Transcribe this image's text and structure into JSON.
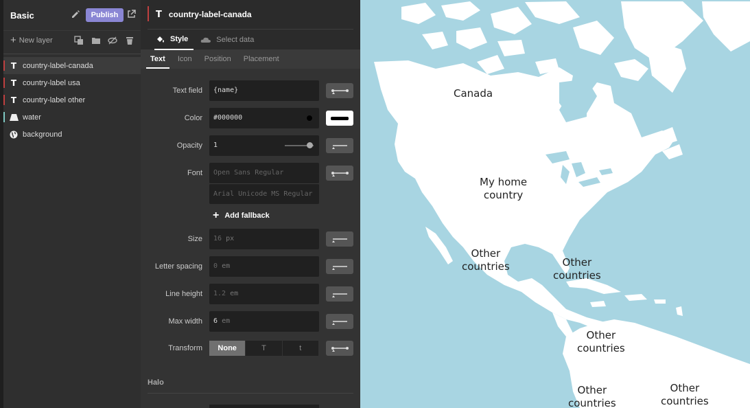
{
  "app": {
    "title": "Basic",
    "publish_label": "Publish",
    "new_layer_label": "New layer"
  },
  "layers": [
    {
      "name": "country-label-canada",
      "type": "symbol",
      "bar_color": "#c04040",
      "active": true
    },
    {
      "name": "country-label usa",
      "type": "symbol",
      "bar_color": "#c04040",
      "active": false
    },
    {
      "name": "country-label other",
      "type": "symbol",
      "bar_color": "#c04040",
      "active": false
    },
    {
      "name": "water",
      "type": "fill",
      "bar_color": "#7fc9c3",
      "active": false
    },
    {
      "name": "background",
      "type": "background",
      "bar_color": "",
      "active": false
    }
  ],
  "editor": {
    "layer_icon": "T",
    "layer_name": "country-label-canada",
    "tabs": {
      "style": "Style",
      "select_data": "Select data"
    },
    "sub_tabs": [
      "Text",
      "Icon",
      "Position",
      "Placement"
    ],
    "active_sub_tab": "Text",
    "properties": {
      "text_field": {
        "label": "Text field",
        "value": "{name}"
      },
      "color": {
        "label": "Color",
        "value": "#000000"
      },
      "opacity": {
        "label": "Opacity",
        "value": "1",
        "level": 1.0
      },
      "font": {
        "label": "Font",
        "placeholder_1": "Open Sans Regular",
        "placeholder_2": "Arial Unicode MS Regular"
      },
      "add_fallback": "Add fallback",
      "size": {
        "label": "Size",
        "value": "16",
        "unit": "px"
      },
      "letter_spacing": {
        "label": "Letter spacing",
        "value": "0",
        "unit": "em"
      },
      "line_height": {
        "label": "Line height",
        "value": "1.2",
        "unit": "em"
      },
      "max_width": {
        "label": "Max width",
        "value": "6",
        "unit": "em"
      },
      "transform": {
        "label": "Transform",
        "options": [
          "None",
          "T",
          "t"
        ],
        "selected": "None"
      }
    },
    "halo_section": "Halo"
  },
  "map": {
    "labels": {
      "canada": "Canada",
      "usa_1": "My home",
      "usa_2": "country",
      "mexico_1": "Other",
      "mexico_2": "countries",
      "cuba_1": "Other",
      "cuba_2": "countries",
      "colombia_1": "Other",
      "colombia_2": "countries",
      "peru_1": "Other",
      "peru_2": "countries",
      "brazil_1": "Other",
      "brazil_2": "countries"
    },
    "water_color": "#a8d5e2",
    "land_color": "#ffffff"
  },
  "colors": {
    "publish_button": "#8a86d4",
    "panel_dark": "#2b2b2b",
    "accent_red": "#c04040"
  }
}
